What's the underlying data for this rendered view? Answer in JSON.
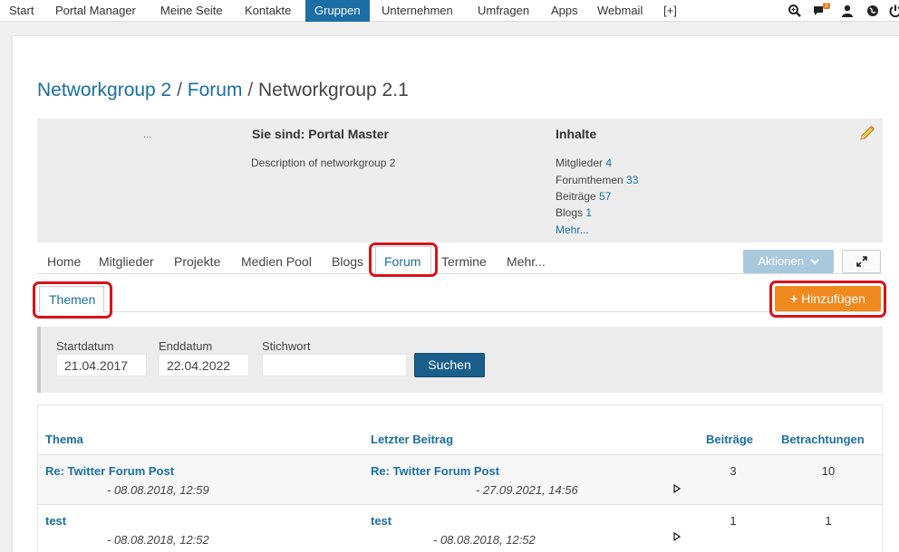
{
  "topnav": {
    "items": [
      "Start",
      "Portal Manager",
      "Meine Seite",
      "Kontakte",
      "Gruppen",
      "Unternehmen",
      "Umfragen",
      "Apps",
      "Webmail",
      "[+]"
    ],
    "active_index": 4,
    "notification_count": "2",
    "icons": [
      "search-icon",
      "chat-icon",
      "user-icon",
      "globe-icon",
      "power-icon"
    ]
  },
  "breadcrumb": {
    "parts": [
      "Networkgroup 2",
      "/",
      "Forum",
      "/",
      "Networkgroup 2.1"
    ]
  },
  "info": {
    "dots": "...",
    "role": "Sie sind: Portal Master",
    "description": "Description of networkgroup 2",
    "content_title": "Inhalte",
    "stats": [
      {
        "label": "Mitglieder",
        "value": "4"
      },
      {
        "label": "Forumthemen",
        "value": "33"
      },
      {
        "label": "Beiträge",
        "value": "57"
      },
      {
        "label": "Blogs",
        "value": "1"
      }
    ],
    "more": "Mehr..."
  },
  "tabs": [
    "Home",
    "Mitglieder",
    "Projekte",
    "Medien Pool",
    "Blogs",
    "Forum",
    "Termine",
    "Mehr..."
  ],
  "active_tab": "Forum",
  "actions_button": "Aktionen",
  "subtab": "Themen",
  "add_button": "Hinzufügen",
  "filter": {
    "start_label": "Startdatum",
    "start_value": "21.04.2017",
    "end_label": "Enddatum",
    "end_value": "22.04.2022",
    "keyword_label": "Stichwort",
    "keyword_value": "",
    "search_button": "Suchen"
  },
  "table": {
    "headers": [
      "Thema",
      "Letzter Beitrag",
      "Beiträge",
      "Betrachtungen"
    ],
    "rows": [
      {
        "topic": "Re: Twitter Forum Post",
        "topic_date": "- 08.08.2018, 12:59",
        "last": "Re: Twitter Forum Post",
        "last_date": "- 27.09.2021, 14:56",
        "posts": "3",
        "views": "10"
      },
      {
        "topic": "test",
        "topic_date": "- 08.08.2018, 12:52",
        "last": "test",
        "last_date": "- 08.08.2018, 12:52",
        "posts": "1",
        "views": "1"
      }
    ]
  },
  "colors": {
    "accent": "#1a6fa0",
    "active_nav": "#1c6ea4",
    "add_button": "#f0891e",
    "highlight": "#d9121a"
  }
}
